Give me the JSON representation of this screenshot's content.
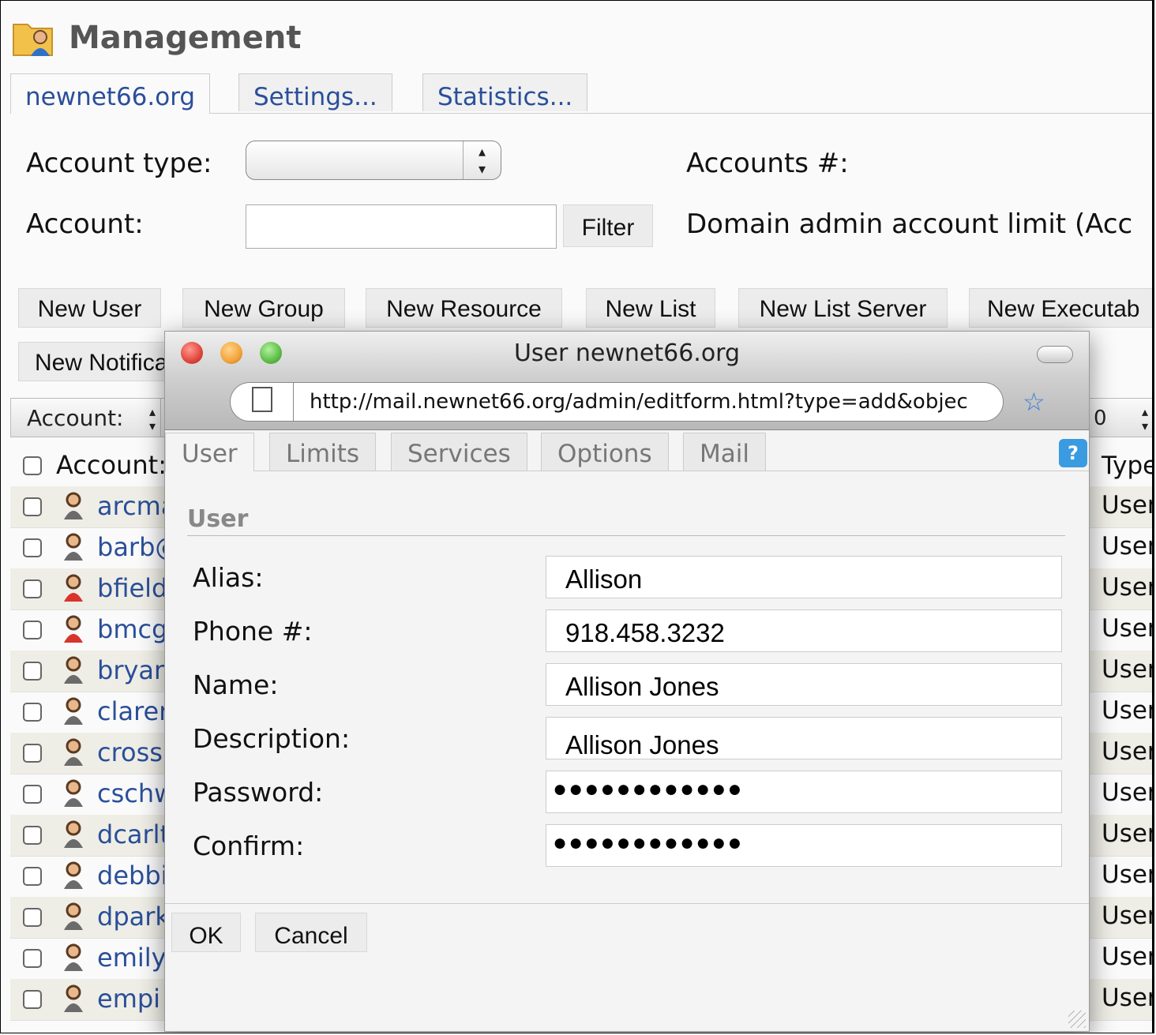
{
  "app": {
    "title": "Management",
    "icon": "folder-user-icon"
  },
  "tabs": [
    {
      "label": "newnet66.org",
      "active": true
    },
    {
      "label": "Settings...",
      "active": false
    },
    {
      "label": "Statistics...",
      "active": false
    }
  ],
  "filters": {
    "account_type_label": "Account type:",
    "account_type_value": "",
    "account_label": "Account:",
    "account_value": "",
    "filter_button": "Filter",
    "accounts_count_label": "Accounts #:",
    "domain_limit_label": "Domain admin account limit (Acc"
  },
  "actions": [
    "New User",
    "New Group",
    "New Resource",
    "New List",
    "New List Server",
    "New Executab",
    "New Notifica"
  ],
  "list_header": {
    "sort_select": "Account:",
    "right_select": "0",
    "col_account": "Account:",
    "col_type": "Type"
  },
  "accounts": [
    {
      "name": "arcma",
      "type": "User",
      "icon": "user-icon"
    },
    {
      "name": "barb@",
      "type": "User",
      "icon": "user-icon"
    },
    {
      "name": "bfield",
      "type": "User",
      "icon": "admin-user-icon"
    },
    {
      "name": "bmcg",
      "type": "User",
      "icon": "admin-user-icon"
    },
    {
      "name": "bryan",
      "type": "User",
      "icon": "user-icon"
    },
    {
      "name": "clarer",
      "type": "User",
      "icon": "user-icon"
    },
    {
      "name": "cross",
      "type": "User",
      "icon": "user-icon"
    },
    {
      "name": "cschw",
      "type": "User",
      "icon": "user-icon"
    },
    {
      "name": "dcarlt",
      "type": "User",
      "icon": "user-icon"
    },
    {
      "name": "debbi",
      "type": "User",
      "icon": "user-icon"
    },
    {
      "name": "dpark",
      "type": "User",
      "icon": "user-icon"
    },
    {
      "name": "emily",
      "type": "User",
      "icon": "user-icon"
    },
    {
      "name": "empi",
      "type": "User",
      "icon": "user-icon"
    }
  ],
  "popup": {
    "window_title": "User newnet66.org",
    "url": "http://mail.newnet66.org/admin/editform.html?type=add&objec",
    "tabs": [
      {
        "label": "User",
        "active": true
      },
      {
        "label": "Limits",
        "active": false
      },
      {
        "label": "Services",
        "active": false
      },
      {
        "label": "Options",
        "active": false
      },
      {
        "label": "Mail",
        "active": false
      }
    ],
    "section_title": "User",
    "fields": [
      {
        "label": "Alias:",
        "value": "Allison"
      },
      {
        "label": "Phone #:",
        "value": "918.458.3232"
      },
      {
        "label": "Name:",
        "value": "Allison Jones"
      },
      {
        "label": "Description:",
        "value": "Allison Jones"
      },
      {
        "label": "Password:",
        "value": "●●●●●●●●●●●●"
      },
      {
        "label": "Confirm:",
        "value": "●●●●●●●●●●●●"
      }
    ],
    "ok_button": "OK",
    "cancel_button": "Cancel",
    "help_icon": "help-icon"
  },
  "colors": {
    "link": "#2a4f9a",
    "row_alt": "#efeee6",
    "close": "#e0453b",
    "minimize": "#f2a33a",
    "zoom": "#5cbd47"
  }
}
